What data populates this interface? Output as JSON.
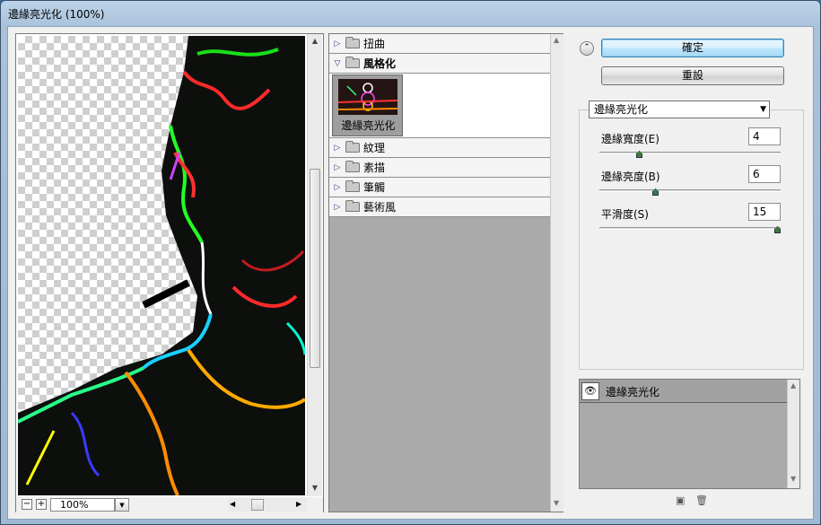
{
  "window": {
    "title": "邊緣亮光化 (100%)"
  },
  "preview": {
    "zoom": "100%",
    "zoom_out": "−",
    "zoom_in": "+"
  },
  "filters": {
    "categories": [
      {
        "label": "扭曲",
        "open": false
      },
      {
        "label": "風格化",
        "open": true
      },
      {
        "label": "紋理",
        "open": false
      },
      {
        "label": "素描",
        "open": false
      },
      {
        "label": "筆觸",
        "open": false
      },
      {
        "label": "藝術風",
        "open": false
      }
    ],
    "selected_thumb_label": "邊緣亮光化"
  },
  "buttons": {
    "ok": "確定",
    "reset": "重設"
  },
  "effect_select": {
    "value": "邊緣亮光化"
  },
  "params": [
    {
      "label": "邊緣寬度(E)",
      "value": "4",
      "level": 0.21
    },
    {
      "label": "邊緣亮度(B)",
      "value": "6",
      "level": 0.3
    },
    {
      "label": "平滑度(S)",
      "value": "15",
      "level": 1.0
    }
  ],
  "layers": {
    "items": [
      {
        "label": "邊緣亮光化"
      }
    ]
  },
  "icons": {
    "eye": "eye-icon",
    "new_layer": "new-layer-icon",
    "trash": "trash-icon"
  }
}
